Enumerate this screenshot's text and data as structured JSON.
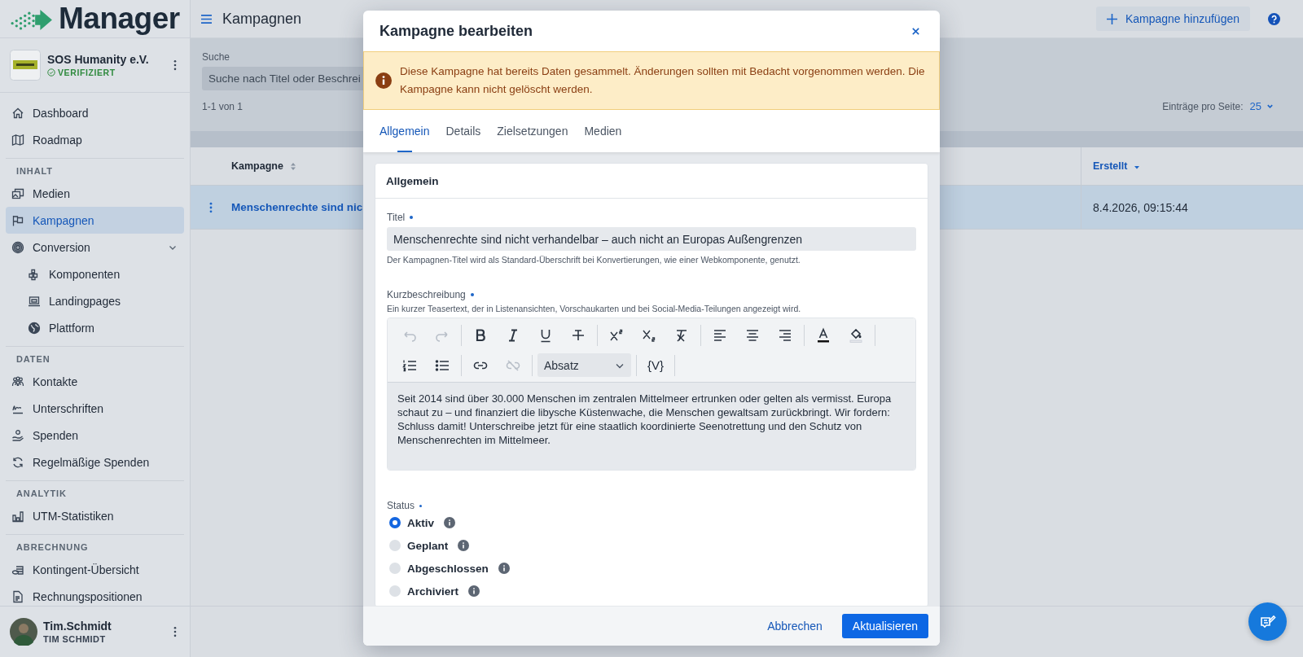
{
  "app": {
    "name": "Manager"
  },
  "organization": {
    "name": "SOS Humanity e.V.",
    "badge": "VERIFIZIERT"
  },
  "sidebar": {
    "sections": [
      {
        "items": [
          {
            "label": "Dashboard",
            "selected": false
          },
          {
            "label": "Roadmap",
            "selected": false
          }
        ]
      },
      {
        "heading": "INHALT",
        "items": [
          {
            "label": "Medien",
            "selected": false
          },
          {
            "label": "Kampagnen",
            "selected": true
          },
          {
            "label": "Conversion",
            "selected": false,
            "expanded": true,
            "children": [
              {
                "label": "Komponenten",
                "selected": false
              },
              {
                "label": "Landingpages",
                "selected": false
              },
              {
                "label": "Plattform",
                "selected": false
              }
            ]
          }
        ]
      },
      {
        "heading": "DATEN",
        "items": [
          {
            "label": "Kontakte",
            "selected": false
          },
          {
            "label": "Unterschriften",
            "selected": false
          },
          {
            "label": "Spenden",
            "selected": false
          },
          {
            "label": "Regelmäßige Spenden",
            "selected": false
          }
        ]
      },
      {
        "heading": "ANALYTIK",
        "items": [
          {
            "label": "UTM-Statistiken",
            "selected": false
          }
        ]
      },
      {
        "heading": "ABRECHNUNG",
        "items": [
          {
            "label": "Kontingent-Übersicht",
            "selected": false
          },
          {
            "label": "Rechnungspositionen",
            "selected": false
          }
        ]
      }
    ]
  },
  "user": {
    "username": "Tim.Schmidt",
    "full_name": "TIM SCHMIDT"
  },
  "topbar": {
    "title": "Kampagnen",
    "add_button": "Kampagne hinzufügen"
  },
  "filters": {
    "search_label": "Suche",
    "search_placeholder": "Suche nach Titel oder Beschrei",
    "count": "1-1 von 1",
    "per_page_label": "Einträge pro Seite:",
    "per_page": "25"
  },
  "table": {
    "columns": [
      {
        "label": "Kampagne",
        "sorted": false
      },
      {
        "label": "Erstellt",
        "sorted": true
      }
    ],
    "rows": [
      {
        "selected": true,
        "title": "Menschenrechte sind nic",
        "created": "8.4.2026, 09:15:44"
      }
    ]
  },
  "modal": {
    "title": "Kampagne bearbeiten",
    "alert": "Diese Kampagne hat bereits Daten gesammelt. Änderungen sollten mit Bedacht vorgenommen werden. Die Kampagne kann nicht gelöscht werden.",
    "tabs": [
      {
        "label": "Allgemein",
        "selected": true
      },
      {
        "label": "Details",
        "selected": false
      },
      {
        "label": "Zielsetzungen",
        "selected": false
      },
      {
        "label": "Medien",
        "selected": false
      }
    ],
    "section_title": "Allgemein",
    "title_field": {
      "label": "Titel",
      "required": true,
      "value": "Menschenrechte sind nicht verhandelbar – auch nicht an Europas Außengrenzen",
      "help": "Der Kampagnen-Titel wird als Standard-Überschrift bei Konvertierungen, wie einer Webkomponente, genutzt."
    },
    "description_field": {
      "label": "Kurzbeschreibung",
      "required": true,
      "help": "Ein kurzer Teasertext, der in Listenansichten, Vorschaukarten und bei Social-Media-Teilungen angezeigt wird.",
      "toolbar_rows": [
        [
          [
            {
              "kind": "undo",
              "disabled": true
            },
            {
              "kind": "redo",
              "disabled": true
            }
          ],
          [
            {
              "kind": "bold",
              "disabled": false
            },
            {
              "kind": "italic",
              "disabled": false
            },
            {
              "kind": "underline",
              "disabled": false
            },
            {
              "kind": "strike",
              "disabled": false
            }
          ],
          [
            {
              "kind": "superscript",
              "disabled": false
            },
            {
              "kind": "subscript",
              "disabled": false
            },
            {
              "kind": "clear",
              "disabled": false
            }
          ],
          [
            {
              "kind": "align-left",
              "disabled": false
            },
            {
              "kind": "align-center",
              "disabled": false
            },
            {
              "kind": "align-right",
              "disabled": false
            }
          ],
          [
            {
              "kind": "text-color",
              "disabled": false
            },
            {
              "kind": "highlight",
              "disabled": false
            }
          ]
        ],
        [
          [
            {
              "kind": "ordered-list",
              "disabled": false
            },
            {
              "kind": "bullet-list",
              "disabled": false
            }
          ],
          [
            {
              "kind": "link",
              "disabled": false
            },
            {
              "kind": "unlink",
              "disabled": true
            }
          ],
          [
            {
              "kind": "select",
              "value": "Absatz"
            }
          ],
          [
            {
              "kind": "variable",
              "label": "{V}"
            }
          ]
        ]
      ],
      "content": "Seit 2014 sind über 30.000 Menschen im zentralen Mittelmeer ertrunken oder gelten als vermisst. Europa schaut zu – und finanziert die libysche Küstenwache, die Menschen gewaltsam zurückbringt. Wir fordern: Schluss damit! Unterschreibe jetzt für eine staatlich koordinierte Seenotrettung und den Schutz von Menschenrechten im Mittelmeer."
    },
    "status_field": {
      "label": "Status",
      "required": true,
      "options": [
        {
          "label": "Aktiv",
          "selected": true
        },
        {
          "label": "Geplant",
          "selected": false
        },
        {
          "label": "Abgeschlossen",
          "selected": false
        },
        {
          "label": "Archiviert",
          "selected": false
        }
      ]
    },
    "cancel_button": "Abbrechen",
    "submit_button": "Aktualisieren"
  }
}
